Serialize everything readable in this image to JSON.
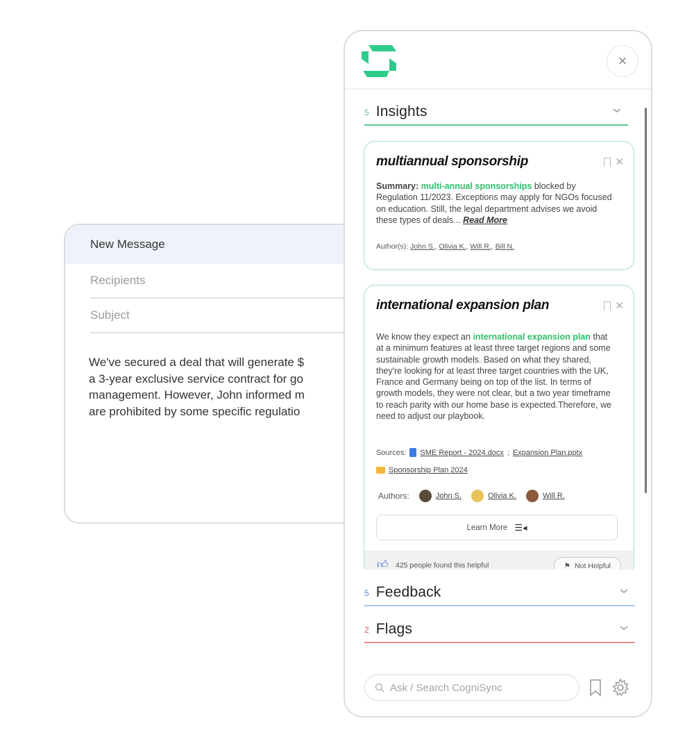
{
  "composer": {
    "title": "New Message",
    "recipients_placeholder": "Recipients",
    "subject_placeholder": "Subject",
    "body_lines": [
      "We've secured a deal that will generate $",
      "a 3-year exclusive service contract for go",
      "management. However, John informed m",
      "are prohibited by some specific regulatio"
    ]
  },
  "panel": {
    "logo": "cognisync-logo",
    "close_icon": "×",
    "sections": {
      "insights": {
        "count": "5",
        "title": "Insights",
        "color": "#5cc98a"
      },
      "feedback": {
        "count": "5",
        "title": "Feedback",
        "color": "#a9c6ec",
        "count_color": "#4a8fe0"
      },
      "flags": {
        "count": "2",
        "title": "Flags",
        "color": "#f08c8c",
        "count_color": "#e25a5a"
      }
    },
    "cards": [
      {
        "title": "multiannual sponsorship",
        "summary_label": "Summary:",
        "summary_highlight": "multi-annual sponsorships",
        "summary_rest": " blocked by Regulation 11/2023. Exceptions may apply for NGOs focused on education. Still, the legal department advises we avoid these types of deals...",
        "read_more": "Read More",
        "authors_label": "Author(s):",
        "authors": [
          "John S.",
          "Olivia K.",
          "Will R.",
          "Bill N."
        ]
      },
      {
        "title": "international expansion plan",
        "text_before": "We know they expect an ",
        "text_highlight": "international expansion plan",
        "text_after": " that at a minimum features at least three target regions and some sustainable growth models. Based on what they shared, they're looking for at least three target countries with the UK, France and Germany being on top of the list. In terms of growth models, they were not clear, but a two year timeframe to reach parity with our home base is expected.Therefore, we need to adjust our playbook.",
        "sources_label": "Sources:",
        "sources": [
          "SME Report - 2024.docx",
          "Expansion Plan.pptx",
          "Sponsorship Plan 2024"
        ],
        "authors_label": "Authors:",
        "authors": [
          "John S.",
          "Olivia K.",
          "Will R."
        ],
        "learn_more": "Learn More",
        "helpful_text": "425 people found this helpful",
        "not_helpful": "Not Helpful"
      }
    ],
    "search_placeholder": "Ask / Search CogniSync"
  }
}
